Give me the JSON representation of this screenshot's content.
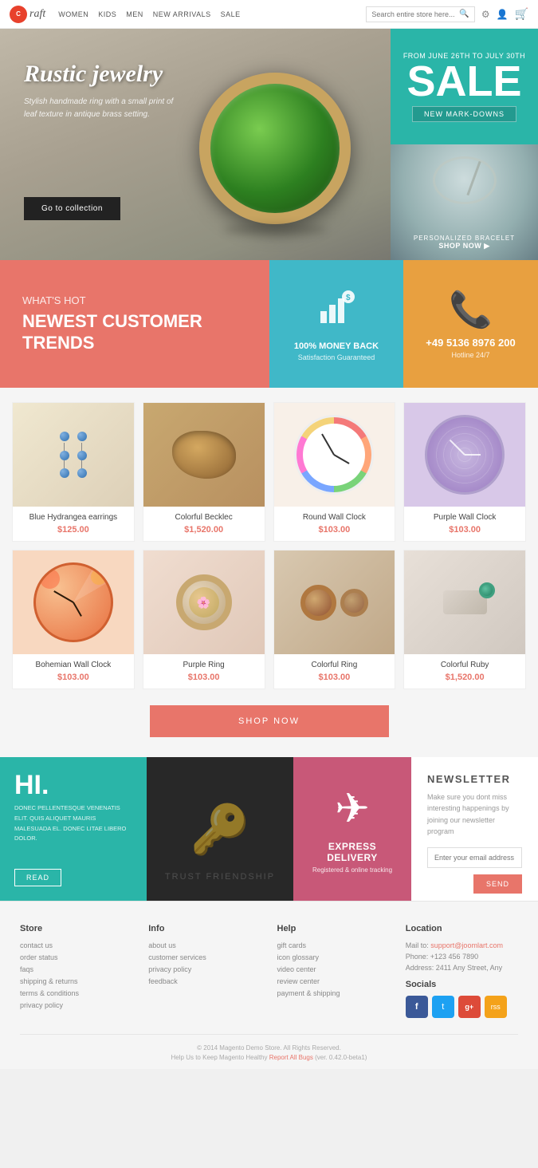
{
  "header": {
    "logo": "raft",
    "nav": [
      "WOMEN",
      "KIDS",
      "MEN",
      "NEW ARRIVALS",
      "SALE"
    ],
    "search_placeholder": "Search entire store here..."
  },
  "hero": {
    "title": "Rustic jewelry",
    "subtitle": "Stylish handmade ring with a small print of leaf texture in antique brass setting.",
    "cta": "Go to collection",
    "sale": {
      "from": "FROM JUNE 26TH TO JULY 30TH",
      "label": "SALE",
      "badge": "NEW MARK-DOWNS"
    },
    "bracelet": {
      "label": "PERSONALIZED BRACELET",
      "shop": "SHOP NOW ▶"
    }
  },
  "promos": {
    "whats_hot_label": "WHAT'S HOT",
    "whats_hot_title": "NEWEST CUSTOMER TRENDS",
    "money_title": "100% MONEY BACK",
    "money_sub": "Satisfaction Guaranteed",
    "phone_number": "+49 5136 8976 200",
    "phone_sub": "Hotline 24/7"
  },
  "products": [
    {
      "name": "Blue Hydrangea earrings",
      "price": "$125.00",
      "img_type": "earrings"
    },
    {
      "name": "Colorful Becklec",
      "price": "$1,520.00",
      "img_type": "becklec"
    },
    {
      "name": "Round Wall Clock",
      "price": "$103.00",
      "img_type": "clock1"
    },
    {
      "name": "Purple Wall Clock",
      "price": "$103.00",
      "img_type": "clock2"
    },
    {
      "name": "Bohemian Wall Clock",
      "price": "$103.00",
      "img_type": "clock3"
    },
    {
      "name": "Purple Ring",
      "price": "$103.00",
      "img_type": "ring1"
    },
    {
      "name": "Colorful Ring",
      "price": "$103.00",
      "img_type": "ring2"
    },
    {
      "name": "Colorful Ruby",
      "price": "$1,520.00",
      "img_type": "ruby"
    }
  ],
  "shop_now": "SHOP NOW",
  "info": {
    "hi_title": "HI.",
    "hi_text": "DONEC PELLENTESQUE VENENATIS ELIT. QUIS ALIQUET MAURIS MALESUADA EL. DONEC LITAE LIBERO DOLOR.",
    "hi_read": "READ",
    "delivery_title": "EXPRESS DELIVERY",
    "delivery_sub": "Registered & online tracking"
  },
  "newsletter": {
    "title": "NEWSLETTER",
    "text": "Make sure you dont miss interesting happenings by joining our newsletter program",
    "input_placeholder": "Enter your email address",
    "send": "SEND"
  },
  "footer": {
    "store_title": "Store",
    "store_links": [
      "contact us",
      "order status",
      "faqs",
      "shipping & returns",
      "terms & conditions",
      "privacy policy"
    ],
    "info_title": "Info",
    "info_links": [
      "about us",
      "customer services",
      "privacy policy",
      "feedback"
    ],
    "help_title": "Help",
    "help_links": [
      "gift cards",
      "icon glossary",
      "video center",
      "review center",
      "payment & shipping"
    ],
    "location_title": "Location",
    "mail_label": "Mail to:",
    "mail_value": "support@joomlart.com",
    "phone": "Phone: +123 456 7890",
    "address": "Address: 2411 Any Street, Any",
    "socials_title": "Socials",
    "social_icons": [
      "f",
      "t",
      "g+",
      "rss"
    ],
    "copyright": "© 2014 Magento Demo Store. All Rights Reserved.",
    "report": "Help Us to Keep Magento Healthy ",
    "report_link": "Report All Bugs",
    "version": " (ver. 0.42.0-beta1)"
  }
}
